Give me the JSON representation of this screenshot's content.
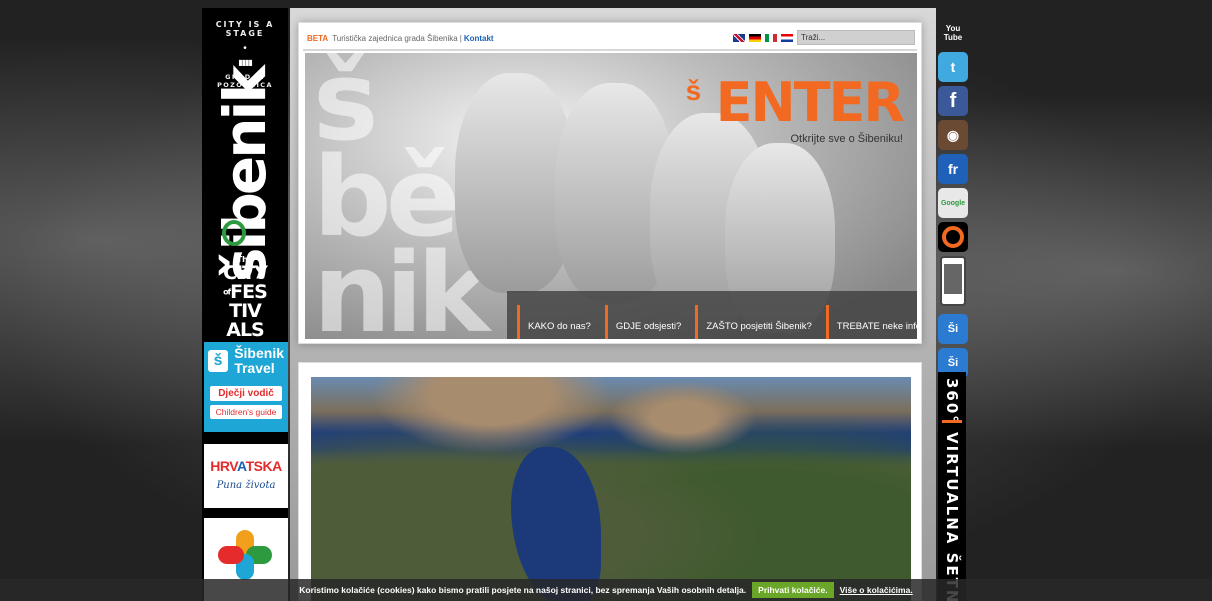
{
  "left": {
    "city_stage": "CITY IS A STAGE",
    "grad_text": "GRAD JE POZORNICA",
    "logo_word": "šibenik",
    "festivals": {
      "the": "The",
      "city": "CITY",
      "of": "of",
      "fes": "FES",
      "tiv": "TIV",
      "als": "ALS"
    },
    "travel": {
      "line1": "Šibenik",
      "line2": "Travel",
      "kids1": "Dječji vodič",
      "kids2": "Children's guide"
    },
    "hrvatska": {
      "word_a": "HRV",
      "word_b": "A",
      "word_c": "TSKA",
      "tagline": "Puna života"
    }
  },
  "topbar": {
    "beta": "BETA",
    "org": "Turistička zajednica grada Šibenika",
    "sep": "|",
    "contact": "Kontakt",
    "search_placeholder": "Traži..."
  },
  "hero": {
    "enter_word": "ENTER",
    "enter_amp": "š",
    "enter_sub": "Otkrijte sve o Šibeniku!",
    "nav": [
      {
        "label": "KAKO do nas?"
      },
      {
        "label": "GDJE odsjesti?"
      },
      {
        "label": "ZAŠTO posjetiti Šibenik?"
      },
      {
        "label": "TREBATE neke informacije?"
      }
    ]
  },
  "social": {
    "youtube": "You Tube",
    "twitter": "t",
    "facebook": "f",
    "flickr": "fr",
    "google": "Google",
    "app1": "Ši",
    "app2": "Ši"
  },
  "virtual_tour": {
    "deg": "360°",
    "label": "VIRTUALNA ŠETNJA"
  },
  "cookie": {
    "text": "Koristimo kolačiće (cookies) kako bismo pratili posjete na našoj stranici, bez spremanja Vaših osobnih detalja.",
    "accept": "Prihvati kolačiće.",
    "more": "Više o kolačićima."
  }
}
